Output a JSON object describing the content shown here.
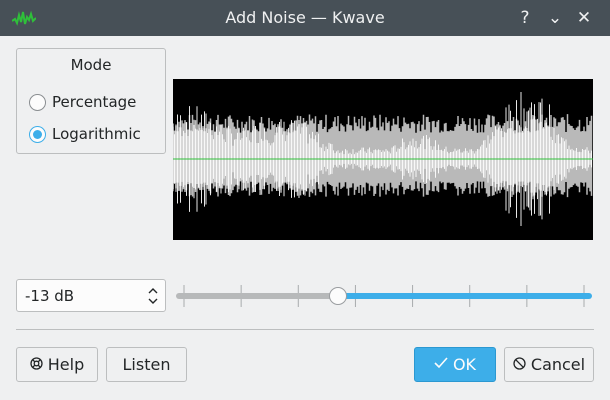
{
  "window": {
    "title": "Add Noise — Kwave",
    "help_glyph": "?",
    "minimize_glyph": "⌄",
    "close_glyph": "✕"
  },
  "mode": {
    "title": "Mode",
    "options": [
      {
        "label": "Percentage",
        "checked": false
      },
      {
        "label": "Logarithmic",
        "checked": true
      }
    ]
  },
  "level": {
    "value_text": "-13 dB",
    "slider_position": 0.385
  },
  "buttons": {
    "help": "Help",
    "listen": "Listen",
    "ok": "OK",
    "cancel": "Cancel"
  },
  "icons": {
    "app": "kwave-waveform-icon",
    "help": "lifebuoy-icon",
    "ok": "checkmark-icon",
    "cancel": "cancel-icon"
  },
  "colors": {
    "accent": "#3daee9",
    "titlebar": "#475057",
    "waveform_bg": "#000000",
    "waveform_signal": "#ffffff",
    "waveform_noise": "#b9b9b9",
    "zero_line": "#2fbf3a"
  }
}
